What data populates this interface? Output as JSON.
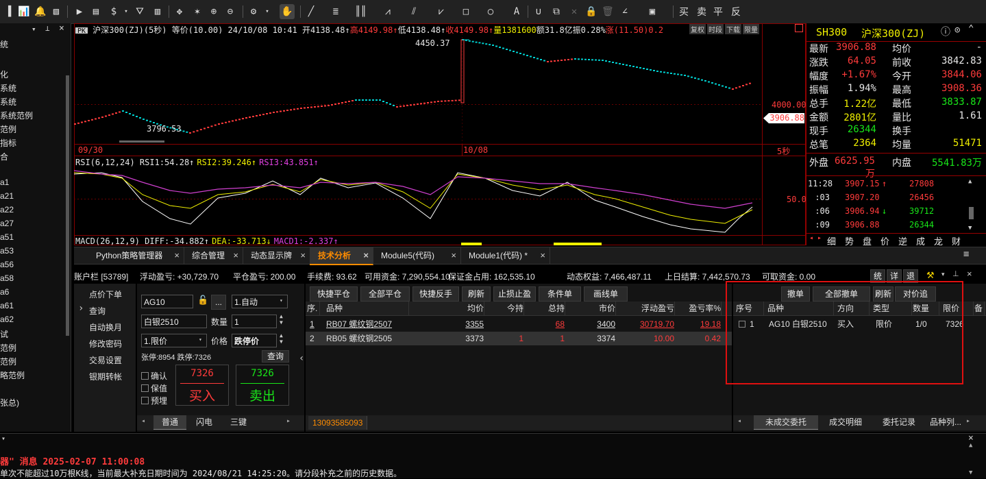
{
  "toolbar": {
    "trade_labels": [
      "买",
      "卖",
      "平",
      "反"
    ]
  },
  "sidebar": {
    "items": [
      "统",
      "化",
      "系统",
      "系统",
      "系统范例",
      "范例",
      "指标",
      "合",
      "a1",
      "a21",
      "a22",
      "a27",
      "a51",
      "a53",
      "a56",
      "a58",
      "a6",
      "a61",
      "a62",
      "试",
      "范例",
      "范例",
      "略范例",
      "张总)"
    ]
  },
  "chart": {
    "badge": "PK",
    "header_title": "沪深300(ZJ)(5秒) 等价(10.00) 24/10/08 10:41",
    "header_stats": [
      {
        "text": "开4138.48↑",
        "color": "#e8e8e8"
      },
      {
        "text": "高4149.98↑",
        "color": "#ff3b3b"
      },
      {
        "text": "低4138.48↑",
        "color": "#e8e8e8"
      },
      {
        "text": "收4149.98↑",
        "color": "#ff3b3b"
      },
      {
        "text": "量1381600",
        "color": "#f0f000"
      },
      {
        "text": "额31.8亿",
        "color": "#e8e8e8"
      },
      {
        "text": "振0.28%",
        "color": "#e8e8e8"
      },
      {
        "text": "涨(11.50)0.2",
        "color": "#ff3b3b"
      }
    ],
    "header_buttons": [
      "复权",
      "时段",
      "下载",
      "限量"
    ],
    "high_label": "4450.37",
    "low_label": "3796.53",
    "price_axis_label": "4000.00",
    "current_price_tag": "3906.88",
    "date_left": "09/30",
    "date_mid": "10/08",
    "period_label": "5秒",
    "rsi_header": [
      {
        "text": "RSI(6,12,24) RSI1:54.28↑",
        "color": "#e8e8e8"
      },
      {
        "text": "RSI2:39.246↑",
        "color": "#f0f000"
      },
      {
        "text": "RSI3:43.851↑",
        "color": "#e040e0"
      }
    ],
    "rsi_axis_label": "50.0",
    "macd_header": [
      {
        "text": "MACD(26,12,9) DIFF:-34.882↑",
        "color": "#e8e8e8"
      },
      {
        "text": "DEA:-33.713↓",
        "color": "#f0f000"
      },
      {
        "text": "MACD1:-2.337↑",
        "color": "#e040e0"
      }
    ]
  },
  "quote": {
    "code": "SH300",
    "name": "沪深300(ZJ)",
    "rows": [
      {
        "l1": "最新",
        "v1": "3906.88",
        "c1": "#ff3b3b",
        "l2": "均价",
        "v2": "-",
        "c2": "#e8e8e8"
      },
      {
        "l1": "涨跌",
        "v1": "64.05",
        "c1": "#ff3b3b",
        "l2": "前收",
        "v2": "3842.83",
        "c2": "#e8e8e8"
      },
      {
        "l1": "幅度",
        "v1": "+1.67%",
        "c1": "#ff3b3b",
        "l2": "今开",
        "v2": "3844.06",
        "c2": "#ff3b3b"
      },
      {
        "l1": "振幅",
        "v1": "1.94%",
        "c1": "#e8e8e8",
        "l2": "最高",
        "v2": "3908.36",
        "c2": "#ff3b3b"
      },
      {
        "l1": "总手",
        "v1": "1.22亿",
        "c1": "#f0f000",
        "l2": "最低",
        "v2": "3833.87",
        "c2": "#19e619"
      },
      {
        "l1": "金额",
        "v1": "2801亿",
        "c1": "#f0f000",
        "l2": "量比",
        "v2": "1.61",
        "c2": "#e8e8e8"
      },
      {
        "l1": "现手",
        "v1": "26344",
        "c1": "#19e619",
        "l2": "换手",
        "v2": "",
        "c2": "#e8e8e8"
      },
      {
        "l1": "总笔",
        "v1": "2364",
        "c1": "#f0f000",
        "l2": "均量",
        "v2": "51471",
        "c2": "#f0f000"
      }
    ],
    "outer_label": "外盘",
    "outer_value": "6625.95万",
    "inner_label": "内盘",
    "inner_value": "5541.83万",
    "ticks": [
      {
        "time": "11:28",
        "price": "3907.15",
        "arrow": "↑",
        "arrow_color": "#ff3b3b",
        "vol": "27808",
        "vol_color": "#ff3b3b"
      },
      {
        "time": ":03",
        "price": "3907.20",
        "arrow": "",
        "arrow_color": "#ff3b3b",
        "vol": "26456",
        "vol_color": "#ff3b3b"
      },
      {
        "time": ":06",
        "price": "3906.94",
        "arrow": "↓",
        "arrow_color": "#19e619",
        "vol": "39712",
        "vol_color": "#19e619"
      },
      {
        "time": ":09",
        "price": "3906.88",
        "arrow": "",
        "arrow_color": "#ff3b3b",
        "vol": "26344",
        "vol_color": "#19e619"
      }
    ],
    "bottom_tabs": [
      "细",
      "势",
      "盘",
      "价",
      "逆",
      "成",
      "龙",
      "财"
    ]
  },
  "tabs": [
    {
      "label": "Python策略管理器",
      "active": false
    },
    {
      "label": "综合管理",
      "active": false
    },
    {
      "label": "动态显示牌",
      "active": false
    },
    {
      "label": "技术分析",
      "active": true
    },
    {
      "label": "Module5(代码)",
      "active": false
    },
    {
      "label": "Module1(代码) *",
      "active": false
    }
  ],
  "account": {
    "items": [
      "账户栏 [53789]",
      "浮动盈亏: +30,729.70",
      "平仓盈亏: 200.00",
      "手续费: 93.62",
      "可用资金: 7,290,554.10",
      "保证金占用: 162,535.10",
      "动态权益: 7,466,487.11",
      "上日结算: 7,442,570.73",
      "可取资金: 0.00"
    ],
    "right_buttons": [
      "统",
      "详",
      "退"
    ]
  },
  "order_menu": [
    "点价下单",
    "查询",
    "自动换月",
    "修改密码",
    "交易设置",
    "银期转帐"
  ],
  "order_form": {
    "code": "AG10",
    "name": "白银2510",
    "mode": "1.自动",
    "qty_label": "数量",
    "qty": "1",
    "price_type": "1.限价",
    "price_label": "价格",
    "price": "跌停价",
    "limit_info": "张停:8954 跌停:7326",
    "query_btn": "查询",
    "checks": [
      "确认",
      "保值",
      "预埋"
    ],
    "buy_price": "7326",
    "buy_label": "买入",
    "sell_price": "7326",
    "sell_label": "卖出",
    "mode_tabs": [
      "普通",
      "闪电",
      "三键"
    ]
  },
  "positions": {
    "buttons": [
      "快捷平仓",
      "全部平仓",
      "快捷反手",
      "刷新",
      "止损止盈",
      "条件单",
      "画线单"
    ],
    "headers": [
      "序.",
      "品种",
      "均价",
      "今持",
      "总持",
      "市价",
      "浮动盈亏",
      "盈亏率%"
    ],
    "rows": [
      {
        "idx": "1",
        "name": "RB07 螺纹钢2507",
        "avg": "3355",
        "today": "",
        "total": "68",
        "market": "3400",
        "pnl": "30719.70",
        "rate": "19.18"
      },
      {
        "idx": "2",
        "name": "RB05 螺纹钢2505",
        "avg": "3373",
        "today": "1",
        "total": "1",
        "market": "3374",
        "pnl": "10.00",
        "rate": "0.42"
      }
    ],
    "phone": "13093585093"
  },
  "orders": {
    "buttons": [
      "撤单",
      "全部撤单",
      "刷新",
      "对价追"
    ],
    "headers": [
      "序号",
      "品种",
      "方向",
      "类型",
      "数量",
      "限价",
      "备"
    ],
    "rows": [
      {
        "idx": "1",
        "name": "AG10 白银2510",
        "dir": "买入",
        "type": "限价",
        "qty": "1/0",
        "price": "7326"
      }
    ],
    "bottom_tabs": [
      "未成交委托",
      "成交明细",
      "委托记录",
      "品种列..."
    ]
  },
  "message": {
    "title": "器\" 消息 2025-02-07 11:00:08",
    "body": "单次不能超过10万根K线，当前最大补充日期时间为 2024/08/21 14:25:20。请分段补充之前的历史数据。"
  }
}
